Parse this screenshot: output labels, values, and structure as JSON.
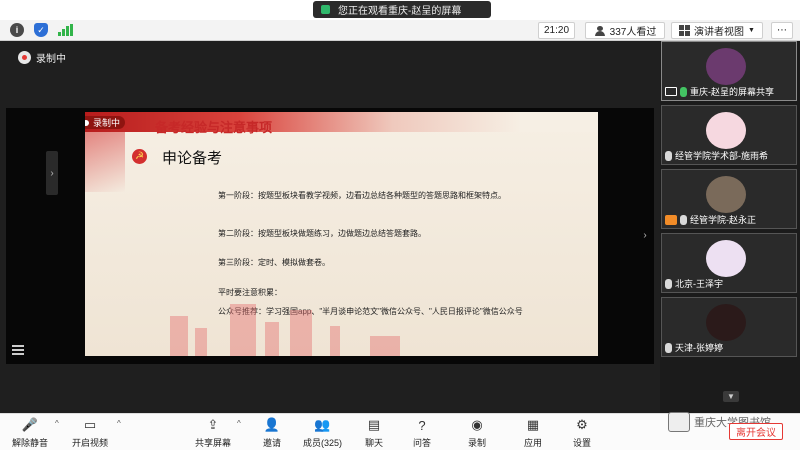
{
  "banner": {
    "text": "您正在观看重庆-赵呈的屏幕"
  },
  "status": {
    "time": "21:20",
    "viewers": "337人看过",
    "speaker_view": "演讲者视图",
    "more": "⋯"
  },
  "recording": {
    "label": "录制中"
  },
  "slide": {
    "rec_label": "录制中",
    "title": "备考经验与注意事项",
    "heading": "申论备考",
    "stage1": "第一阶段：按题型板块看教学视频，边看边总结各种题型的答题思路和框架特点。",
    "stage2": "第二阶段：按题型板块做题练习，边做题边总结答题套路。",
    "stage3": "第三阶段：定时、模拟做套卷。",
    "tip_head": "平时要注意积累：",
    "tip_body": "公众号推荐：学习强国app、\"半月谈申论范文\"微信公众号、\"人民日报评论\"微信公众号"
  },
  "participants": [
    {
      "name": "重庆-赵呈的屏幕共享",
      "avatar_color": "#6b3a6e"
    },
    {
      "name": "经管学院学术部-施雨希",
      "avatar_color": "#f6d8e0"
    },
    {
      "name": "经管学院-赵永正",
      "avatar_color": "#7a6a5a"
    },
    {
      "name": "北京-王泽宇",
      "avatar_color": "#ede0f2"
    },
    {
      "name": "天津-张婷婷",
      "avatar_color": "#2b1a1a"
    }
  ],
  "toolbar": {
    "unmute": "解除静音",
    "start_video": "开启视频",
    "share": "共享屏幕",
    "invite": "邀请",
    "members": "成员(325)",
    "chat": "聊天",
    "qa": "问答",
    "record": "录制",
    "apps": "应用",
    "settings": "设置",
    "leave": "离开会议"
  },
  "watermark": "重庆大学图书馆",
  "colors": {
    "accent_red": "#e53935",
    "signal_green": "#32b44a",
    "slide_red": "#c62828"
  }
}
